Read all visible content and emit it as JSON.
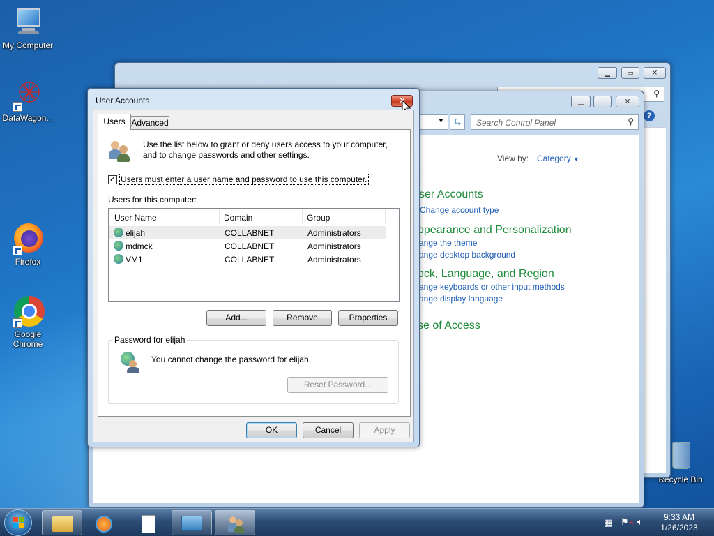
{
  "desktop": {
    "icons": [
      {
        "label": "My Computer"
      },
      {
        "label": "DataWagon..."
      },
      {
        "label": "Firefox"
      },
      {
        "label": "Google Chrome"
      },
      {
        "label": "Recycle Bin"
      }
    ]
  },
  "control_panel": {
    "search_placeholder": "Search Control Panel",
    "view_by_label": "View by:",
    "view_by_value": "Category",
    "sections": [
      {
        "heading": "ser Accounts",
        "links": [
          "Change account type"
        ]
      },
      {
        "heading": "ppearance and Personalization",
        "links": [
          "ange the theme",
          "ange desktop background"
        ]
      },
      {
        "heading": "ock, Language, and Region",
        "links": [
          "ange keyboards or other input methods",
          "ange display language"
        ]
      },
      {
        "heading": "se of Access",
        "links": []
      }
    ]
  },
  "dialog": {
    "title": "User Accounts",
    "tabs": [
      "Users",
      "Advanced"
    ],
    "intro": "Use the list below to grant or deny users access to your computer, and to change passwords and other settings.",
    "checkbox_label": "Users must enter a user name and password to use this computer.",
    "checkbox_checked": true,
    "users_label": "Users for this computer:",
    "columns": [
      "User Name",
      "Domain",
      "Group"
    ],
    "users": [
      {
        "name": "elijah",
        "domain": "COLLABNET",
        "group": "Administrators"
      },
      {
        "name": "mdmck",
        "domain": "COLLABNET",
        "group": "Administrators"
      },
      {
        "name": "VM1",
        "domain": "COLLABNET",
        "group": "Administrators"
      }
    ],
    "add_button": "Add...",
    "remove_button": "Remove",
    "properties_button": "Properties",
    "password_group_title": "Password for elijah",
    "password_message": "You cannot change the password for elijah.",
    "reset_password_button": "Reset Password...",
    "ok_button": "OK",
    "cancel_button": "Cancel",
    "apply_button": "Apply"
  },
  "taskbar": {
    "time": "9:33 AM",
    "date": "1/26/2023"
  }
}
